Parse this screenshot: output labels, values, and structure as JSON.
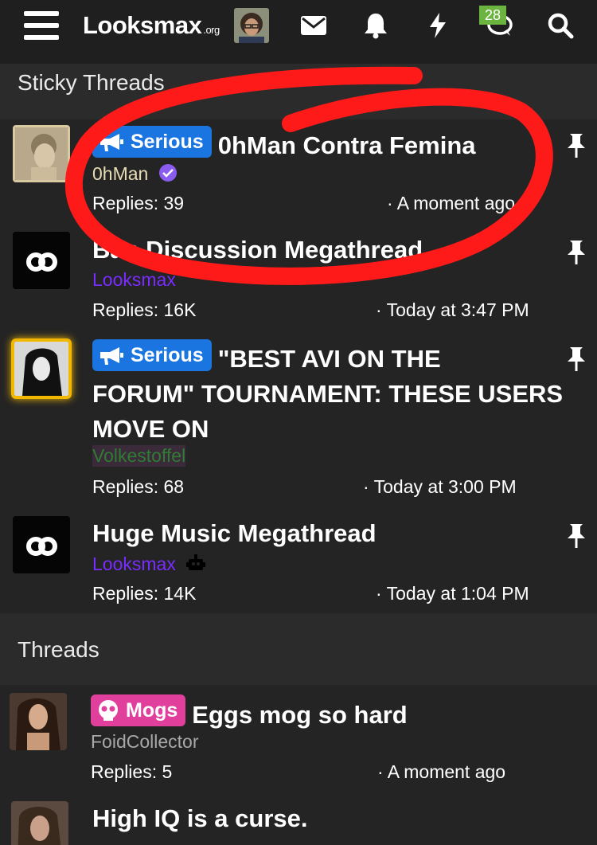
{
  "header": {
    "logo_main": "Looksmax",
    "logo_suffix": ".org",
    "notification_count": "28"
  },
  "sticky_section": {
    "title": "Sticky Threads",
    "threads": [
      {
        "prefix": "Serious",
        "title": "0hMan Contra Femina",
        "author": "0hMan",
        "replies": "Replies: 39",
        "time": "· A moment ago"
      },
      {
        "prefix": "",
        "title": "Ban Discussion Megathread",
        "author": "Looksmax",
        "replies": "Replies: 16K",
        "time": "· Today at 3:47 PM"
      },
      {
        "prefix": "Serious",
        "title_line1": "\"BEST AVI ON THE",
        "title_line2": "FORUM\" TOURNAMENT: THESE USERS",
        "title_line3": "MOVE ON",
        "author": "Volkestoffel",
        "replies": "Replies: 68",
        "time": "· Today at 3:00 PM"
      },
      {
        "prefix": "",
        "title": "Huge Music Megathread",
        "author": "Looksmax",
        "replies": "Replies: 14K",
        "time": "· Today at 1:04 PM"
      }
    ]
  },
  "threads_section": {
    "title": "Threads",
    "threads": [
      {
        "prefix": "Mogs",
        "title": "Eggs mog so hard",
        "author": "FoidCollector",
        "replies": "Replies: 5",
        "time": "· A moment ago"
      },
      {
        "prefix": "",
        "title": "High IQ is a curse.",
        "author": "",
        "replies": "",
        "time": ""
      }
    ]
  },
  "colors": {
    "serious_prefix": "#1b75e0",
    "mogs_prefix": "#e0409b",
    "staff_name": "#7a2cff",
    "annotation_red": "#ff1a1a",
    "badge_green": "#6bb43f"
  }
}
